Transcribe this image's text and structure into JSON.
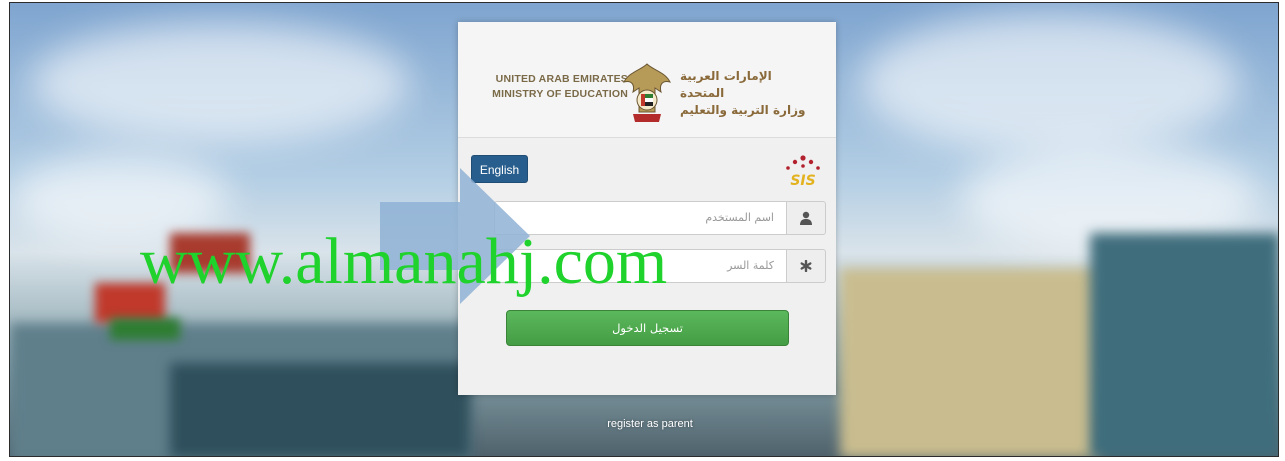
{
  "header": {
    "en_title_line1": "UNITED ARAB EMIRATES",
    "en_title_line2": "MINISTRY OF EDUCATION",
    "ar_title_line1": "الإمارات العربية المتحدة",
    "ar_title_line2": "وزارة التربية والتعليم",
    "emblem_icon": "uae-emblem-icon"
  },
  "language_button": "English",
  "logo": {
    "text": "SIS",
    "icon": "sis-logo-icon"
  },
  "form": {
    "username_placeholder": "اسم المستخدم",
    "username_icon": "user-icon",
    "password_placeholder": "كلمة السر",
    "password_icon": "asterisk-icon",
    "login_label": "تسجيل الدخول"
  },
  "register_link": "register as parent",
  "watermark": "www.almanahj.com",
  "colors": {
    "language_button": "#285e8e",
    "login_button": "#5cb85c",
    "watermark": "#1fd22c",
    "arrow": "#8fb1d5"
  }
}
